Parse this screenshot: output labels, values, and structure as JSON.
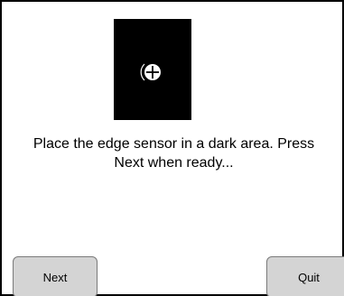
{
  "dialog": {
    "message": "Place the edge sensor in a dark area. Press\nNext when ready...",
    "sensor_icon": "crosshair-circle-icon"
  },
  "buttons": {
    "next_label": "Next",
    "quit_label": "Quit"
  },
  "colors": {
    "image_background": "#000000",
    "button_face": "#d4d4d4",
    "border": "#000000"
  }
}
